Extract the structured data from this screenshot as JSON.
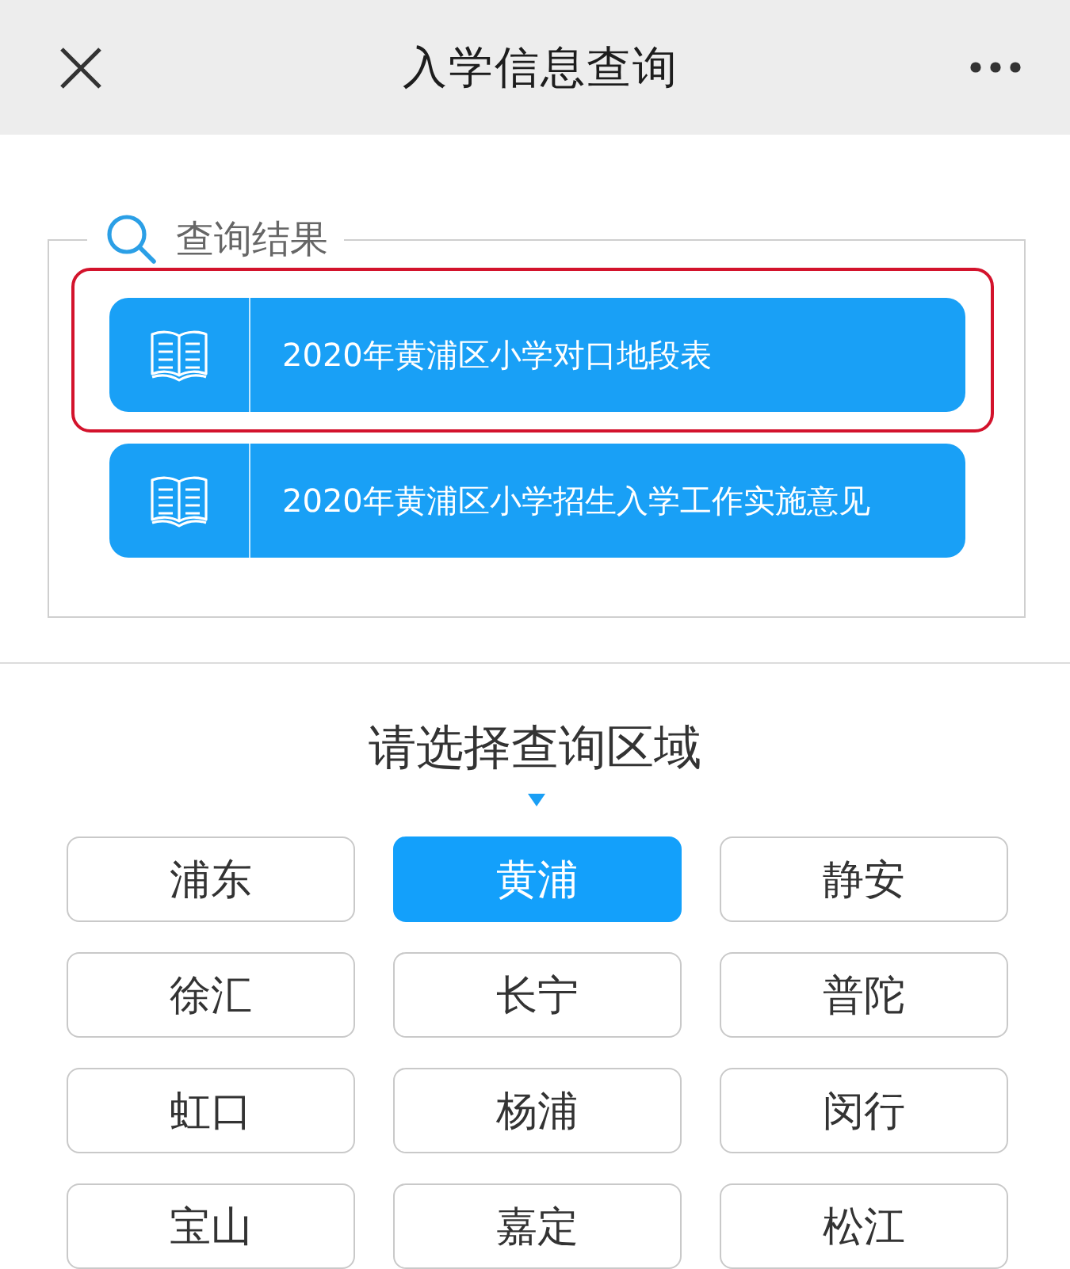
{
  "header": {
    "title": "入学信息查询"
  },
  "results": {
    "legend": "查询结果",
    "items": [
      {
        "label": "2020年黄浦区小学对口地段表",
        "highlighted": true
      },
      {
        "label": "2020年黄浦区小学招生入学工作实施意见",
        "highlighted": false
      }
    ]
  },
  "district_picker": {
    "heading": "请选择查询区域",
    "districts": [
      {
        "label": "浦东",
        "selected": false
      },
      {
        "label": "黄浦",
        "selected": true
      },
      {
        "label": "静安",
        "selected": false
      },
      {
        "label": "徐汇",
        "selected": false
      },
      {
        "label": "长宁",
        "selected": false
      },
      {
        "label": "普陀",
        "selected": false
      },
      {
        "label": "虹口",
        "selected": false
      },
      {
        "label": "杨浦",
        "selected": false
      },
      {
        "label": "闵行",
        "selected": false
      },
      {
        "label": "宝山",
        "selected": false
      },
      {
        "label": "嘉定",
        "selected": false
      },
      {
        "label": "松江",
        "selected": false
      }
    ]
  }
}
